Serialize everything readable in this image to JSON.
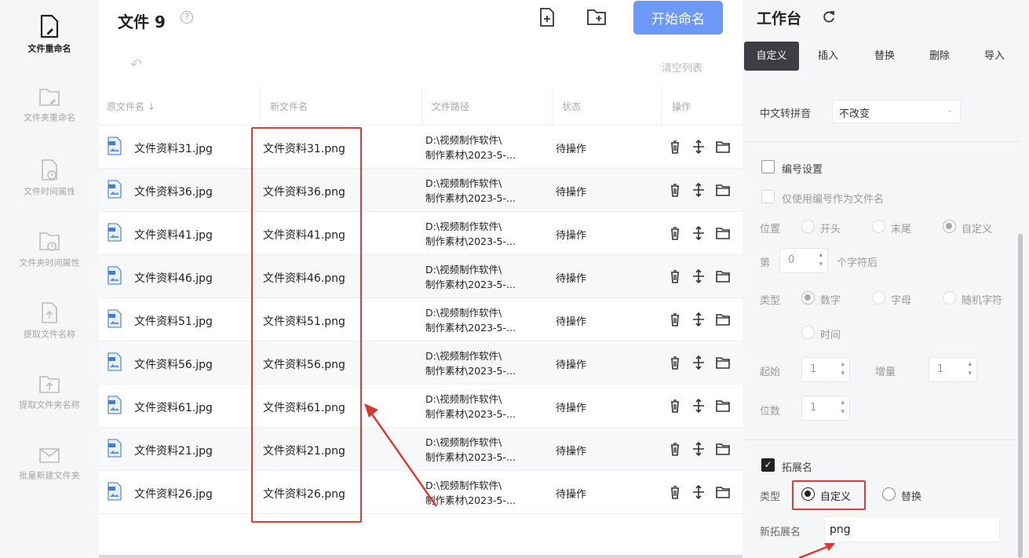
{
  "sidebar": {
    "items": [
      {
        "label": "文件重命名",
        "icon": "file-rename-icon"
      },
      {
        "label": "文件夹重命名",
        "icon": "folder-rename-icon"
      },
      {
        "label": "文件时间属性",
        "icon": "file-time-icon"
      },
      {
        "label": "文件夹时间属性",
        "icon": "folder-time-icon"
      },
      {
        "label": "提取文件名称",
        "icon": "extract-file-icon"
      },
      {
        "label": "提取文件夹名称",
        "icon": "extract-folder-icon"
      },
      {
        "label": "批量新建文件夹",
        "icon": "batch-folder-icon"
      }
    ]
  },
  "header": {
    "title": "文件 9",
    "help_icon": "?",
    "start_button": "开始命名"
  },
  "toolbar": {
    "clear_list": "清空列表"
  },
  "table": {
    "columns": [
      "原文件名 ↓",
      "新文件名",
      "文件路径",
      "状态",
      "操作"
    ],
    "rows": [
      {
        "orig": "文件资料31.jpg",
        "new": "文件资料31.png",
        "path1": "D:\\视频制作软件\\",
        "path2": "制作素材\\2023-5-...",
        "status": "待操作"
      },
      {
        "orig": "文件资料36.jpg",
        "new": "文件资料36.png",
        "path1": "D:\\视频制作软件\\",
        "path2": "制作素材\\2023-5-...",
        "status": "待操作"
      },
      {
        "orig": "文件资料41.jpg",
        "new": "文件资料41.png",
        "path1": "D:\\视频制作软件\\",
        "path2": "制作素材\\2023-5-...",
        "status": "待操作"
      },
      {
        "orig": "文件资料46.jpg",
        "new": "文件资料46.png",
        "path1": "D:\\视频制作软件\\",
        "path2": "制作素材\\2023-5-...",
        "status": "待操作"
      },
      {
        "orig": "文件资料51.jpg",
        "new": "文件资料51.png",
        "path1": "D:\\视频制作软件\\",
        "path2": "制作素材\\2023-5-...",
        "status": "待操作"
      },
      {
        "orig": "文件资料56.jpg",
        "new": "文件资料56.png",
        "path1": "D:\\视频制作软件\\",
        "path2": "制作素材\\2023-5-...",
        "status": "待操作"
      },
      {
        "orig": "文件资料61.jpg",
        "new": "文件资料61.png",
        "path1": "D:\\视频制作软件\\",
        "path2": "制作素材\\2023-5-...",
        "status": "待操作"
      },
      {
        "orig": "文件资料21.jpg",
        "new": "文件资料21.png",
        "path1": "D:\\视频制作软件\\",
        "path2": "制作素材\\2023-5-...",
        "status": "待操作"
      },
      {
        "orig": "文件资料26.jpg",
        "new": "文件资料26.png",
        "path1": "D:\\视频制作软件\\",
        "path2": "制作素材\\2023-5-...",
        "status": "待操作"
      }
    ]
  },
  "workspace": {
    "title": "工作台",
    "tabs": [
      "自定义",
      "插入",
      "替换",
      "删除",
      "导入"
    ],
    "active_tab": "自定义",
    "pinyin_label": "中文转拼音",
    "pinyin_value": "不改变",
    "numbering_label": "编号设置",
    "only_number_label": "仅使用编号作为文件名",
    "position_label": "位置",
    "position_options": [
      "开头",
      "末尾",
      "自定义"
    ],
    "position_selected": "自定义",
    "nth_label": "第",
    "nth_value": "0",
    "after_chars_label": "个字符后",
    "type_label": "类型",
    "type_options": [
      "数字",
      "字母",
      "随机字符",
      "时间"
    ],
    "type_selected": "数字",
    "start_label": "起始",
    "start_value": "1",
    "step_label": "增量",
    "step_value": "1",
    "digits_label": "位数",
    "digits_value": "1",
    "ext_label": "拓展名",
    "ext_checked": true,
    "ext_type_label": "类型",
    "ext_type_options": [
      "自定义",
      "替换"
    ],
    "ext_type_selected": "自定义",
    "new_ext_label": "新拓展名",
    "new_ext_value": "png"
  },
  "colors": {
    "accent": "#6e98f8",
    "highlight": "#e53935",
    "tab_active": "#3c3e43"
  }
}
